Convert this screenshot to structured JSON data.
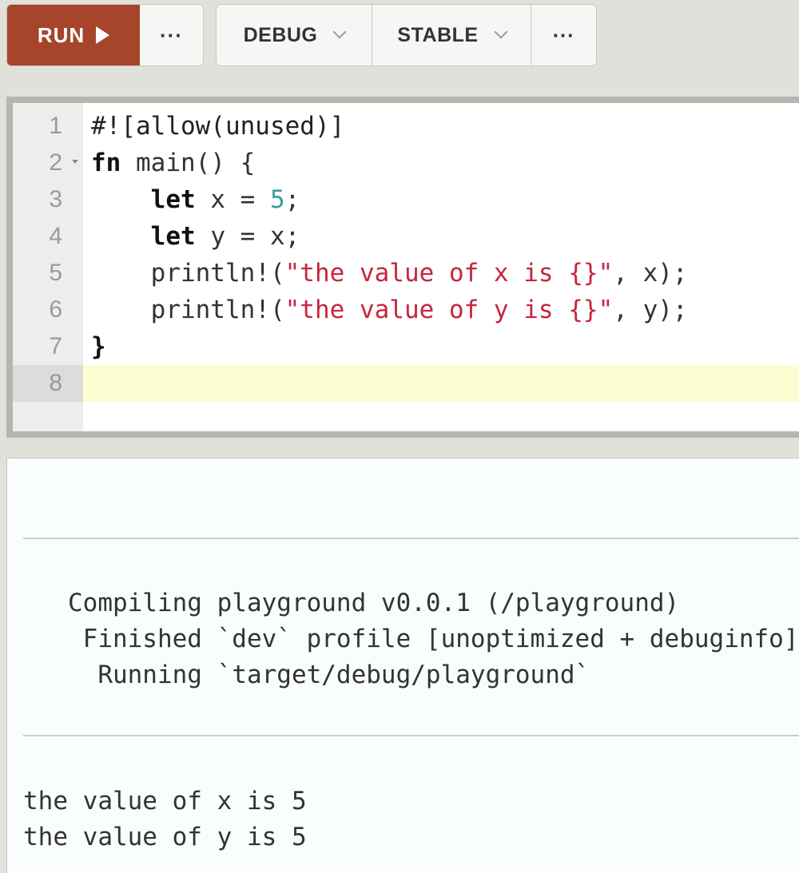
{
  "toolbar": {
    "run_label": "RUN",
    "run_more_label": "···",
    "mode_label": "DEBUG",
    "channel_label": "STABLE",
    "config_more_label": "···"
  },
  "editor": {
    "line_numbers": [
      "1",
      "2",
      "3",
      "4",
      "5",
      "6",
      "7",
      "8"
    ],
    "active_line": 8,
    "lines": [
      [
        {
          "t": "#![allow(unused)]",
          "c": "attr"
        }
      ],
      [
        {
          "t": "fn",
          "c": "kw"
        },
        {
          "t": " main() {",
          "c": ""
        }
      ],
      [
        {
          "t": "    ",
          "c": ""
        },
        {
          "t": "let",
          "c": "kw"
        },
        {
          "t": " x = ",
          "c": ""
        },
        {
          "t": "5",
          "c": "num"
        },
        {
          "t": ";",
          "c": ""
        }
      ],
      [
        {
          "t": "    ",
          "c": ""
        },
        {
          "t": "let",
          "c": "kw"
        },
        {
          "t": " y = x;",
          "c": ""
        }
      ],
      [
        {
          "t": "    println!(",
          "c": ""
        },
        {
          "t": "\"the value of x is {}\"",
          "c": "str"
        },
        {
          "t": ", x);",
          "c": ""
        }
      ],
      [
        {
          "t": "    println!(",
          "c": ""
        },
        {
          "t": "\"the value of y is {}\"",
          "c": "str"
        },
        {
          "t": ", y);",
          "c": ""
        }
      ],
      [
        {
          "t": "}",
          "c": "kw"
        }
      ],
      []
    ]
  },
  "output": {
    "stderr": [
      "   Compiling playground v0.0.1 (/playground)",
      "    Finished `dev` profile [unoptimized + debuginfo] target(s)",
      "     Running `target/debug/playground`"
    ],
    "stdout": [
      "the value of x is 5",
      "the value of y is 5"
    ]
  }
}
